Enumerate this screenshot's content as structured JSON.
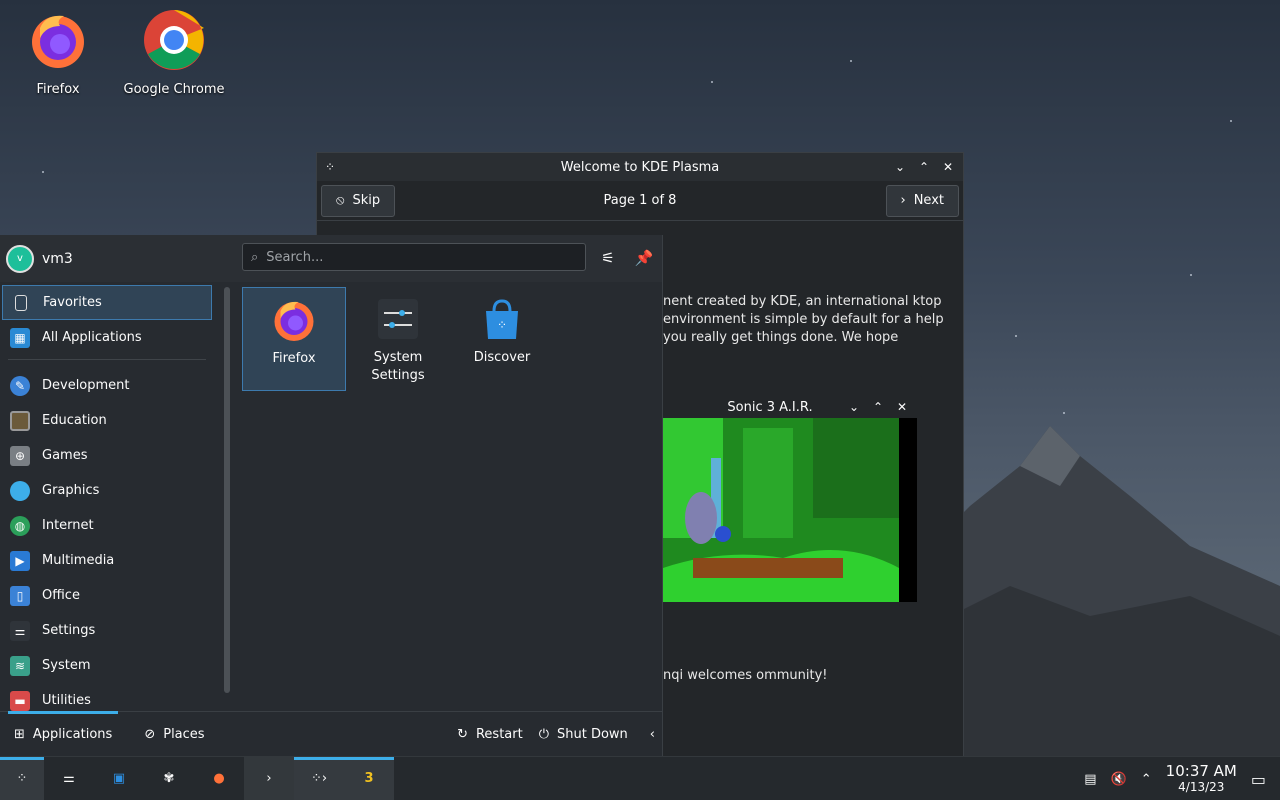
{
  "desktop": {
    "icons": [
      {
        "label": "Firefox"
      },
      {
        "label": "Google Chrome"
      }
    ]
  },
  "welcome": {
    "title": "Welcome to KDE Plasma",
    "skip_label": "Skip",
    "pager": "Page 1 of 8",
    "next_label": "Next",
    "text1": "nent created by KDE, an international ktop environment is simple by default for a help you really get things done. We hope",
    "text2": "nqi welcomes ommunity!"
  },
  "sonic": {
    "title": "Sonic 3 A.I.R."
  },
  "launcher": {
    "username": "vm3",
    "avatar_letter": "v",
    "search_placeholder": "Search...",
    "categories": [
      {
        "label": "Favorites",
        "icon": "bookmark-icon"
      },
      {
        "label": "All Applications",
        "icon": "grid-icon"
      },
      {
        "label": "Development",
        "icon": "development-icon"
      },
      {
        "label": "Education",
        "icon": "education-icon"
      },
      {
        "label": "Games",
        "icon": "gamepad-icon"
      },
      {
        "label": "Graphics",
        "icon": "graphics-icon"
      },
      {
        "label": "Internet",
        "icon": "globe-icon"
      },
      {
        "label": "Multimedia",
        "icon": "multimedia-icon"
      },
      {
        "label": "Office",
        "icon": "office-icon"
      },
      {
        "label": "Settings",
        "icon": "settings-icon"
      },
      {
        "label": "System",
        "icon": "system-icon"
      },
      {
        "label": "Utilities",
        "icon": "utilities-icon"
      }
    ],
    "apps": [
      {
        "label": "Firefox"
      },
      {
        "label": "System Settings"
      },
      {
        "label": "Discover"
      }
    ],
    "bottom": {
      "applications": "Applications",
      "places": "Places",
      "restart": "Restart",
      "shutdown": "Shut Down"
    }
  },
  "taskbar": {
    "time": "10:37 AM",
    "date": "4/13/23"
  },
  "colors": {
    "accent": "#3daee9",
    "panel": "#25292d",
    "window": "#232629"
  }
}
